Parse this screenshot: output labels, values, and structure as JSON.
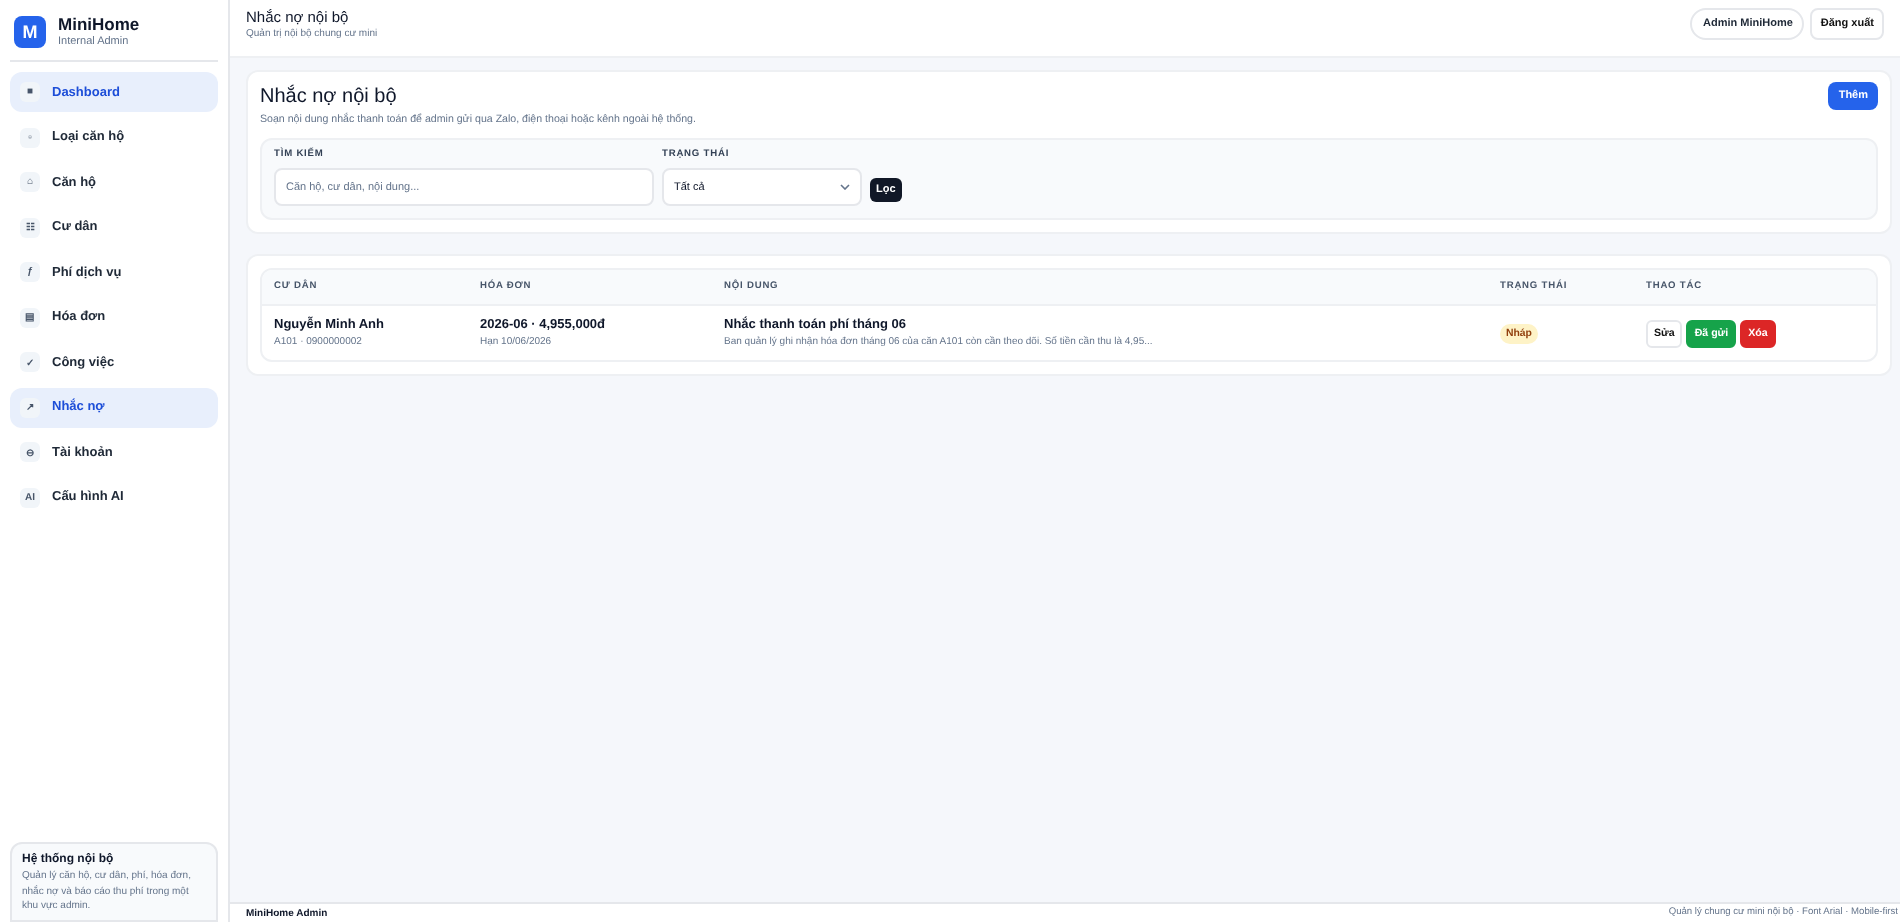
{
  "brand": {
    "logo": "M",
    "name": "MiniHome",
    "subtitle": "Internal Admin"
  },
  "sidebar": {
    "items": [
      {
        "icon": "■",
        "label": "Dashboard",
        "selected": true
      },
      {
        "icon": "▫",
        "label": "Loại căn hộ",
        "selected": false
      },
      {
        "icon": "⌂",
        "label": "Căn hộ",
        "selected": false
      },
      {
        "icon": "☷",
        "label": "Cư dân",
        "selected": false
      },
      {
        "icon": "ƒ",
        "label": "Phí dịch vụ",
        "selected": false
      },
      {
        "icon": "▤",
        "label": "Hóa đơn",
        "selected": false
      },
      {
        "icon": "✓",
        "label": "Công việc",
        "selected": false
      },
      {
        "icon": "↗",
        "label": "Nhắc nợ",
        "selected": true
      },
      {
        "icon": "⊖",
        "label": "Tài khoản",
        "selected": false
      },
      {
        "icon": "AI",
        "label": "Cấu hình AI",
        "selected": false
      }
    ],
    "info": {
      "title": "Hệ thống nội bộ",
      "text": "Quản lý căn hộ, cư dân, phí, hóa đơn, nhắc nợ và báo cáo thu phí trong một khu vực admin."
    }
  },
  "header": {
    "title": "Nhắc nợ nội bộ",
    "subtitle": "Quản trị nội bộ chung cư mini",
    "user": "Admin MiniHome",
    "logout": "Đăng xuất"
  },
  "panel": {
    "title": "Nhắc nợ nội bộ",
    "description": "Soạn nội dung nhắc thanh toán để admin gửi qua Zalo, điện thoại hoặc kênh ngoài hệ thống.",
    "add_button": "Thêm",
    "filters": {
      "search_label": "TÌM KIẾM",
      "search_placeholder": "Căn hộ, cư dân, nội dung...",
      "status_label": "TRẠNG THÁI",
      "status_value": "Tất cả",
      "filter_button": "Lọc"
    }
  },
  "table": {
    "columns": [
      "CƯ DÂN",
      "HÓA ĐƠN",
      "NỘI DUNG",
      "TRẠNG THÁI",
      "THAO TÁC"
    ],
    "rows": [
      {
        "resident": "Nguyễn Minh Anh",
        "resident_sub": "A101 · 0900000002",
        "invoice": "2026-06 · 4,955,000đ",
        "invoice_sub": "Hạn 10/06/2026",
        "content_title": "Nhắc thanh toán phí tháng 06",
        "content_text": "Ban quản lý ghi nhận hóa đơn tháng 06 của căn A101 còn cần theo dõi. Số tiền cần thu là 4,95...",
        "status": "Nháp",
        "color": "#fef3c7",
        "actions": [
          {
            "label": "Sửa",
            "kind": "neutral"
          },
          {
            "label": "Đã gửi",
            "kind": "success"
          },
          {
            "label": "Xóa",
            "kind": "danger"
          }
        ]
      }
    ]
  },
  "footer": {
    "left": "MiniHome Admin",
    "right": "Quản lý chung cư mini nội bộ · Font Arial · Mobile-first"
  }
}
